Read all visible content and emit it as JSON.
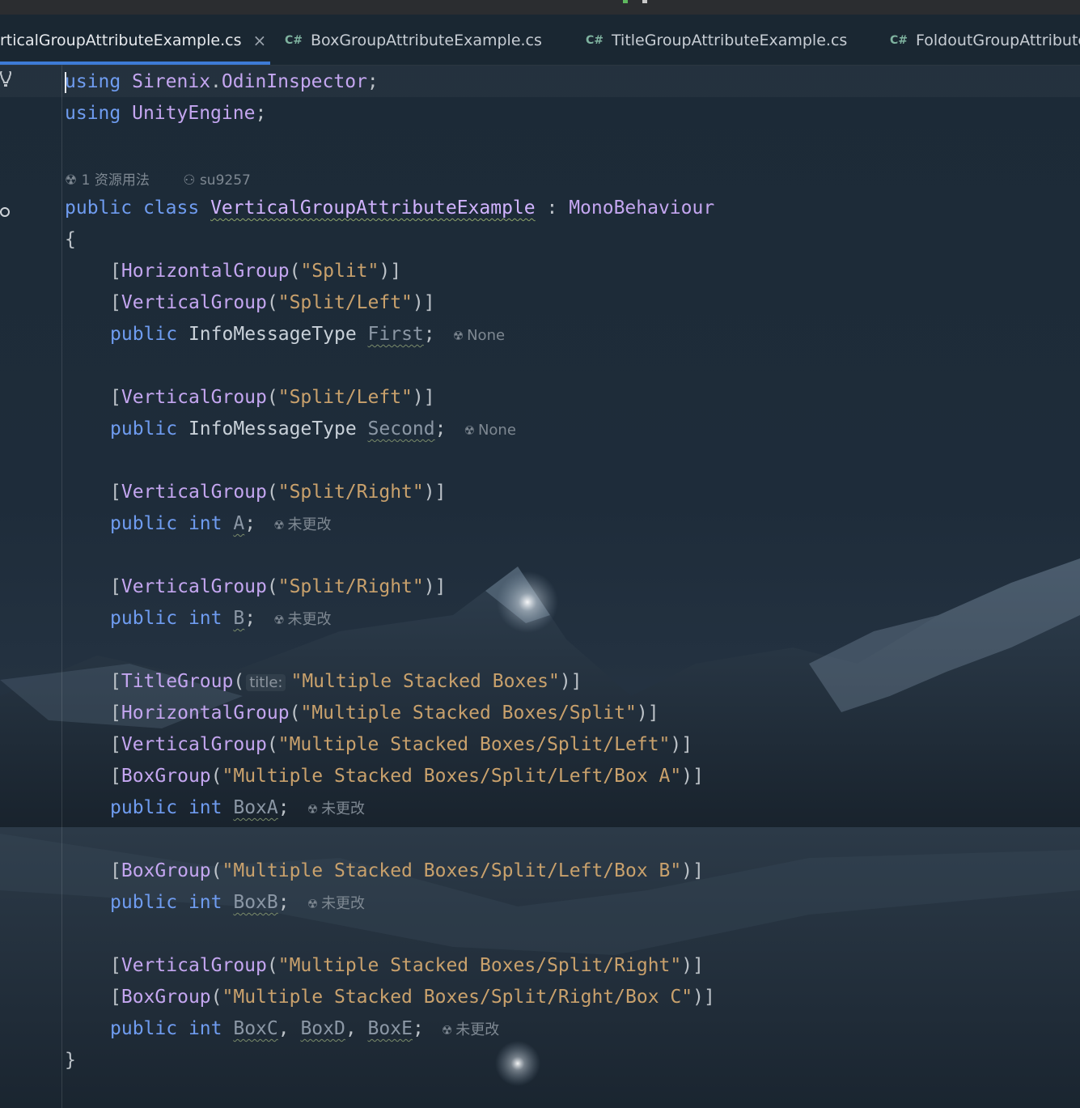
{
  "tabs": [
    {
      "label": "rticalGroupAttributeExample.cs",
      "active": true,
      "closable": true
    },
    {
      "label": "BoxGroupAttributeExample.cs",
      "lang": "C#"
    },
    {
      "label": "TitleGroupAttributeExample.cs",
      "lang": "C#"
    },
    {
      "label": "FoldoutGroupAttribute",
      "lang": "C#"
    }
  ],
  "tab_close_glyph": "×",
  "lens": {
    "usages": "1 资源用法",
    "author": "su9257"
  },
  "code": {
    "l1": {
      "kw": "using",
      "ns": "Sirenix",
      "dot": ".",
      "ns2": "OdinInspector",
      "end": ";"
    },
    "l2": {
      "kw": "using",
      "ns": "UnityEngine",
      "end": ";"
    },
    "l4": {
      "kw1": "public",
      "kw2": "class",
      "name": "VerticalGroupAttributeExample",
      "colon": " : ",
      "base": "MonoBehaviour"
    },
    "open": "{",
    "close": "}",
    "a1": {
      "open": "[",
      "attr": "HorizontalGroup",
      "lp": "(",
      "str": "\"Split\"",
      "rp": ")]"
    },
    "a2": {
      "open": "[",
      "attr": "VerticalGroup",
      "lp": "(",
      "str": "\"Split/Left\"",
      "rp": ")]"
    },
    "f1": {
      "kw": "public",
      "type": "InfoMessageType",
      "name": "First",
      "end": ";",
      "hint": "None"
    },
    "a3": {
      "open": "[",
      "attr": "VerticalGroup",
      "lp": "(",
      "str": "\"Split/Left\"",
      "rp": ")]"
    },
    "f2": {
      "kw": "public",
      "type": "InfoMessageType",
      "name": "Second",
      "end": ";",
      "hint": "None"
    },
    "a4": {
      "open": "[",
      "attr": "VerticalGroup",
      "lp": "(",
      "str": "\"Split/Right\"",
      "rp": ")]"
    },
    "f3": {
      "kw": "public",
      "type": "int",
      "name": "A",
      "end": ";",
      "hint": "未更改"
    },
    "a5": {
      "open": "[",
      "attr": "VerticalGroup",
      "lp": "(",
      "str": "\"Split/Right\"",
      "rp": ")]"
    },
    "f4": {
      "kw": "public",
      "type": "int",
      "name": "B",
      "end": ";",
      "hint": "未更改"
    },
    "a6": {
      "open": "[",
      "attr": "TitleGroup",
      "lp": "(",
      "param": "title:",
      "str": "\"Multiple Stacked Boxes\"",
      "rp": ")]"
    },
    "a7": {
      "open": "[",
      "attr": "HorizontalGroup",
      "lp": "(",
      "str": "\"Multiple Stacked Boxes/Split\"",
      "rp": ")]"
    },
    "a8": {
      "open": "[",
      "attr": "VerticalGroup",
      "lp": "(",
      "str": "\"Multiple Stacked Boxes/Split/Left\"",
      "rp": ")]"
    },
    "a9": {
      "open": "[",
      "attr": "BoxGroup",
      "lp": "(",
      "str": "\"Multiple Stacked Boxes/Split/Left/Box A\"",
      "rp": ")]"
    },
    "f5": {
      "kw": "public",
      "type": "int",
      "name": "BoxA",
      "end": ";",
      "hint": "未更改"
    },
    "a10": {
      "open": "[",
      "attr": "BoxGroup",
      "lp": "(",
      "str": "\"Multiple Stacked Boxes/Split/Left/Box B\"",
      "rp": ")]"
    },
    "f6": {
      "kw": "public",
      "type": "int",
      "name": "BoxB",
      "end": ";",
      "hint": "未更改"
    },
    "a11": {
      "open": "[",
      "attr": "VerticalGroup",
      "lp": "(",
      "str": "\"Multiple Stacked Boxes/Split/Right\"",
      "rp": ")]"
    },
    "a12": {
      "open": "[",
      "attr": "BoxGroup",
      "lp": "(",
      "str": "\"Multiple Stacked Boxes/Split/Right/Box C\"",
      "rp": ")]"
    },
    "f7": {
      "kw": "public",
      "type": "int",
      "n1": "BoxC",
      "c1": ", ",
      "n2": "BoxD",
      "c2": ", ",
      "n3": "BoxE",
      "end": ";",
      "hint": "未更改"
    }
  },
  "colors": {
    "keyword": "#6f9cf0",
    "type": "#c4a6f0",
    "string": "#c9a16c",
    "tab_active_underline": "#3d7bd6"
  }
}
